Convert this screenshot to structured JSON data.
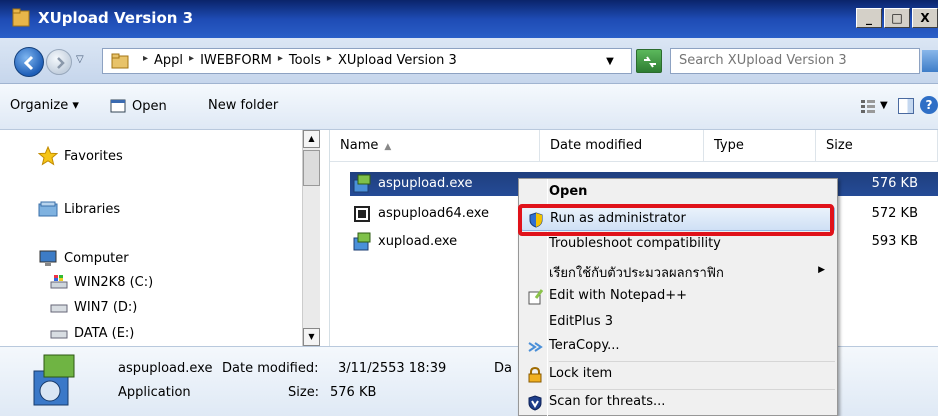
{
  "window": {
    "title": "XUpload Version 3"
  },
  "titlebar_buttons": {
    "minimize": "_",
    "restore": "□",
    "close": "X"
  },
  "address": {
    "crumbs": [
      "Appl",
      "IWEBFORM",
      "Tools",
      "XUpload Version 3"
    ],
    "separator": "▸"
  },
  "search": {
    "placeholder": "Search XUpload Version 3"
  },
  "commands": {
    "organize": "Organize ▾",
    "open": "Open",
    "new_folder": "New folder"
  },
  "nav": {
    "favorites": "Favorites",
    "libraries": "Libraries",
    "computer": "Computer",
    "drives": [
      "WIN2K8 (C:)",
      "WIN7 (D:)",
      "DATA (E:)"
    ]
  },
  "columns": {
    "name": "Name",
    "date": "Date modified",
    "type": "Type",
    "size": "Size"
  },
  "files": [
    {
      "name": "aspupload.exe",
      "date": "3/11/2553 18:39",
      "type": "Application",
      "size": "576 KB"
    },
    {
      "name": "aspupload64.exe",
      "size": "572 KB"
    },
    {
      "name": "xupload.exe",
      "size": "593 KB"
    }
  ],
  "details": {
    "filename": "aspupload.exe",
    "date_label": "Date modified:",
    "date_value": "3/11/2553 18:39",
    "kind": "Application",
    "size_label": "Size:",
    "size_value": "576 KB",
    "extra_cut": "Da"
  },
  "context_menu": {
    "open": "Open",
    "run_as_admin": "Run as administrator",
    "troubleshoot": "Troubleshoot compatibility",
    "thai_graphics": "เรียกใช้กับตัวประมวลผลกราฟิก",
    "notepadpp": "Edit with Notepad++",
    "editplus": "EditPlus 3",
    "teracopy": "TeraCopy...",
    "lock": "Lock item",
    "scan": "Scan for threats..."
  },
  "colors": {
    "highlight": "#e0121a",
    "selection": "#254b96"
  }
}
